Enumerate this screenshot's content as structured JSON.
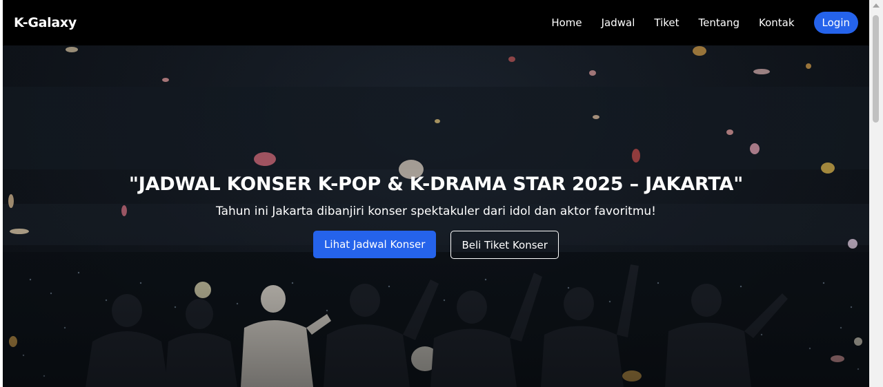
{
  "navbar": {
    "brand": "K-Galaxy",
    "links": [
      "Home",
      "Jadwal",
      "Tiket",
      "Tentang",
      "Kontak"
    ],
    "login_label": "Login"
  },
  "hero": {
    "title": "\"JADWAL KONSER K-POP & K-DRAMA STAR 2025 – JAKARTA\"",
    "subtitle": "Tahun ini Jakarta dibanjiri konser spektakuler dari idol dan aktor favoritmu!",
    "primary_button": "Lihat Jadwal Konser",
    "secondary_button": "Beli Tiket Konser",
    "background": "concert-crowd-photo"
  },
  "colors": {
    "navbar_bg": "#000000",
    "accent": "#2563eb",
    "text": "#ffffff"
  }
}
